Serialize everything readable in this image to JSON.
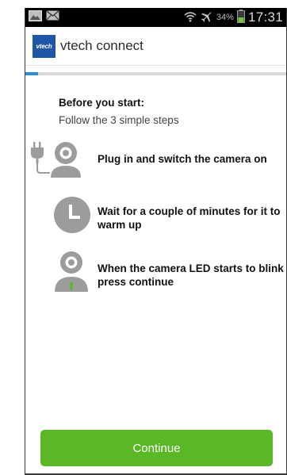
{
  "status_bar": {
    "left_icons": [
      "image-icon",
      "mail-icon"
    ],
    "right_icons": [
      "wifi-icon",
      "airplane-icon",
      "battery-icon"
    ],
    "battery_percent": "34%",
    "time": "17:31"
  },
  "app_bar": {
    "logo_text": "vtech",
    "title": "vtech connect"
  },
  "progress": {
    "fraction": 0.05,
    "color": "#2f8ed8"
  },
  "intro": {
    "title": "Before you start:",
    "subtitle": "Follow the 3 simple steps"
  },
  "steps": [
    {
      "icon": "plug-camera-icon",
      "text": "Plug in and switch the camera on"
    },
    {
      "icon": "clock-icon",
      "text": "Wait for a couple of minutes for it to warm up"
    },
    {
      "icon": "camera-led-icon",
      "text": "When the camera LED starts to blink press continue"
    }
  ],
  "continue_button": {
    "label": "Continue",
    "color": "#5ab725"
  }
}
